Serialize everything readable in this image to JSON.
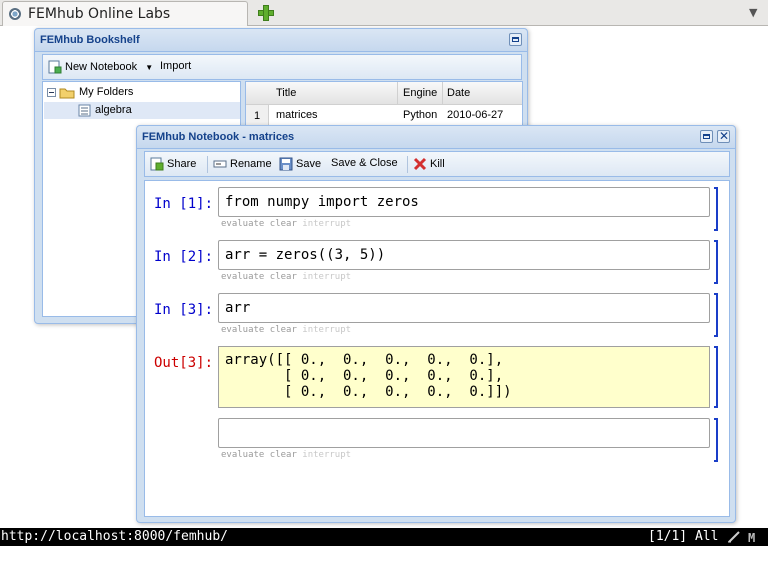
{
  "browser": {
    "tab_title": "FEMhub Online Labs",
    "tab_list_icon": "chevron-down-icon"
  },
  "bookshelf": {
    "title": "FEMhub Bookshelf",
    "toolbar": {
      "new_notebook": "New Notebook",
      "import": "Import"
    },
    "tree": {
      "root": "My Folders",
      "child": "algebra"
    },
    "grid": {
      "columns": [
        "Title",
        "Engine",
        "Date"
      ],
      "rows": [
        {
          "num": "1",
          "title": "matrices",
          "engine": "Python",
          "date": "2010-06-27"
        }
      ]
    }
  },
  "notebook": {
    "title": "FEMhub Notebook - matrices",
    "toolbar": {
      "share": "Share",
      "rename": "Rename",
      "save": "Save",
      "save_close": "Save & Close",
      "kill": "Kill"
    },
    "cells": [
      {
        "prompt": "In [1]:",
        "code": "from numpy import zeros",
        "actions": {
          "evaluate": "evaluate",
          "clear": "clear",
          "interrupt": "interrupt"
        }
      },
      {
        "prompt": "In [2]:",
        "code": "arr = zeros((3, 5))",
        "actions": {
          "evaluate": "evaluate",
          "clear": "clear",
          "interrupt": "interrupt"
        }
      },
      {
        "prompt": "In [3]:",
        "code": "arr",
        "actions": {
          "evaluate": "evaluate",
          "clear": "clear",
          "interrupt": "interrupt"
        }
      },
      {
        "prompt": "Out[3]:",
        "output": "array([[ 0.,  0.,  0.,  0.,  0.],\n       [ 0.,  0.,  0.,  0.,  0.],\n       [ 0.,  0.,  0.,  0.,  0.]])"
      },
      {
        "prompt": "",
        "code": "",
        "actions": {
          "evaluate": "evaluate",
          "clear": "clear",
          "interrupt": "interrupt"
        }
      }
    ]
  },
  "statusbar": {
    "url": "http://localhost:8000/femhub/",
    "position": "[1/1] All"
  },
  "colors": {
    "prompt_in": "#0000cc",
    "prompt_out": "#cc0000",
    "output_bg": "#ffffcc",
    "window_title": "#15428b"
  }
}
